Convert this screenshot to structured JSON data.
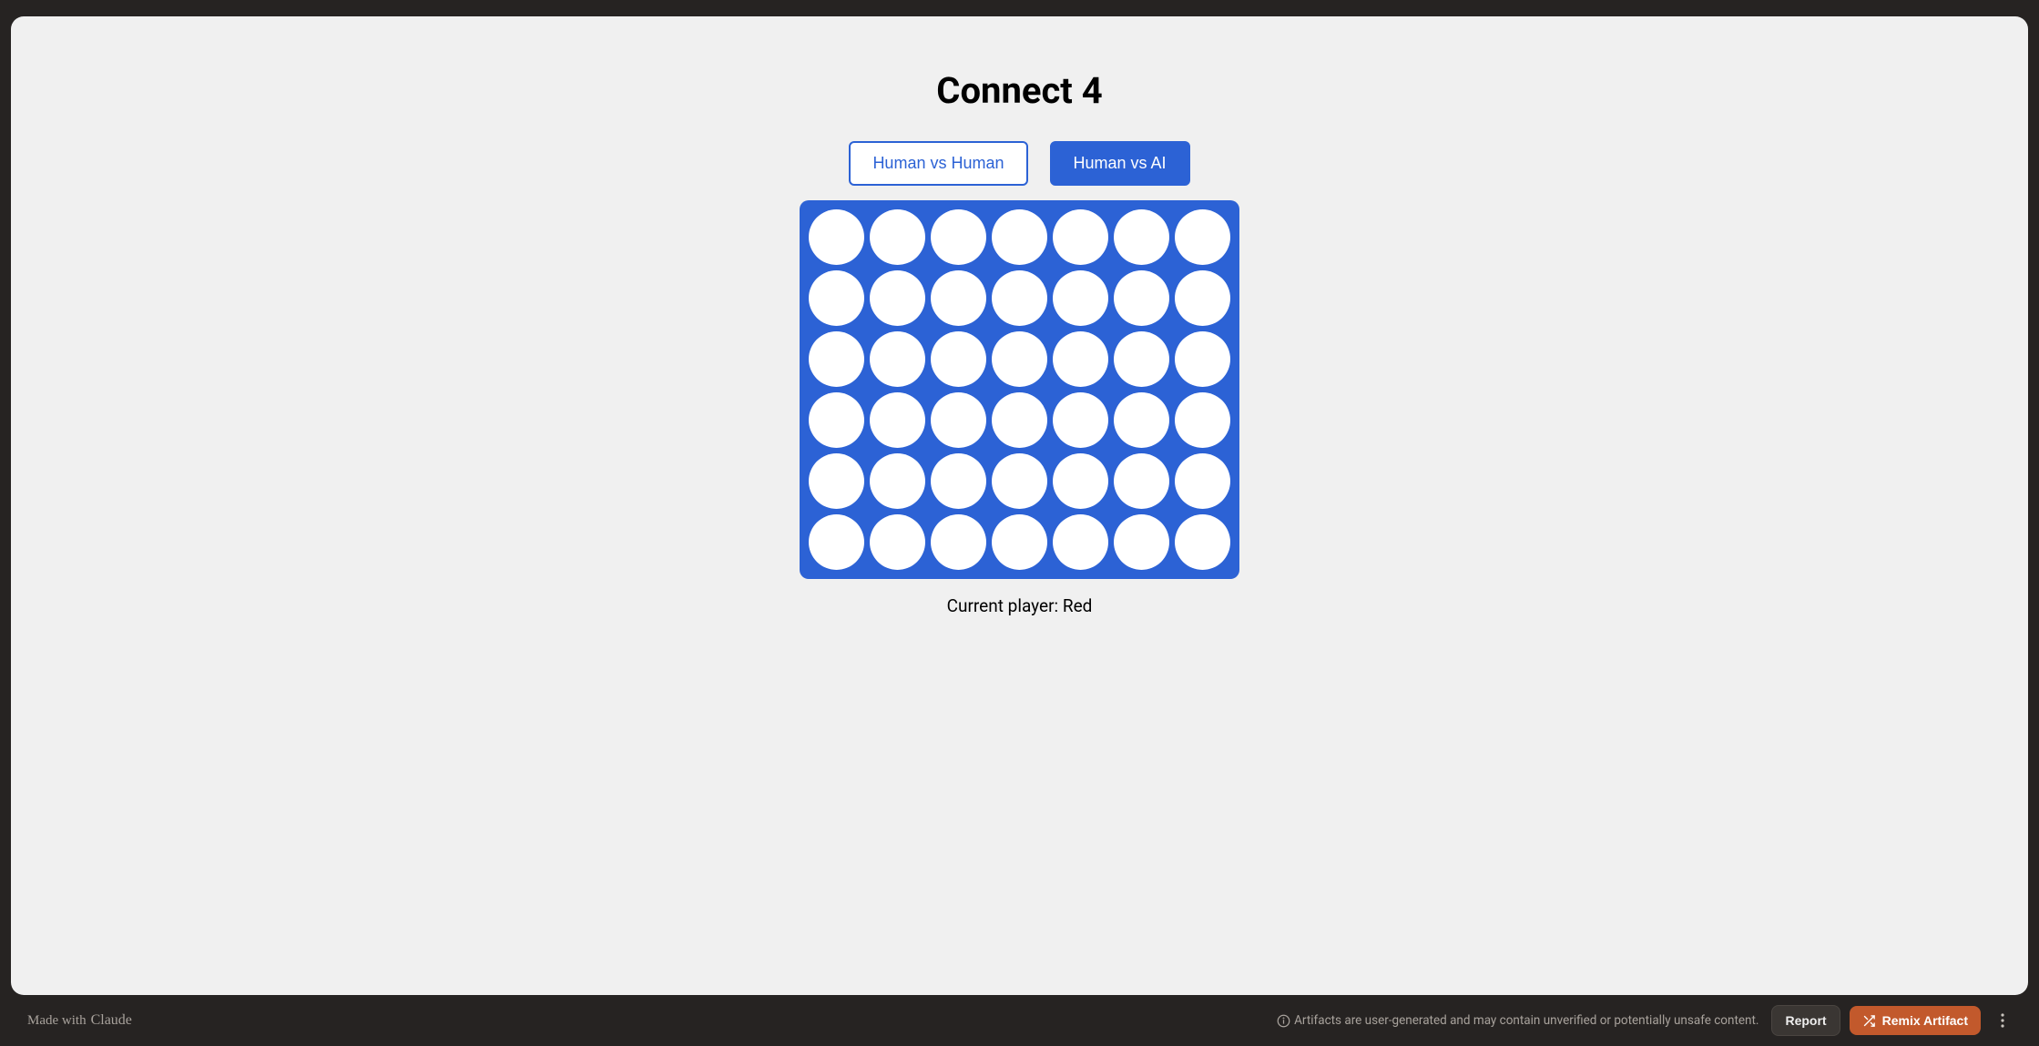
{
  "game": {
    "title": "Connect 4",
    "modes": {
      "human_vs_human": "Human vs Human",
      "human_vs_ai": "Human vs AI",
      "active": "human_vs_ai"
    },
    "board": {
      "rows": 6,
      "cols": 7,
      "cells": [
        [
          "empty",
          "empty",
          "empty",
          "empty",
          "empty",
          "empty",
          "empty"
        ],
        [
          "empty",
          "empty",
          "empty",
          "empty",
          "empty",
          "empty",
          "empty"
        ],
        [
          "empty",
          "empty",
          "empty",
          "empty",
          "empty",
          "empty",
          "empty"
        ],
        [
          "empty",
          "empty",
          "empty",
          "empty",
          "empty",
          "empty",
          "empty"
        ],
        [
          "empty",
          "empty",
          "empty",
          "empty",
          "empty",
          "empty",
          "empty"
        ],
        [
          "empty",
          "empty",
          "empty",
          "empty",
          "empty",
          "empty",
          "empty"
        ]
      ]
    },
    "status": "Current player: Red",
    "colors": {
      "board": "#2c62d5",
      "empty": "#ffffff",
      "accent": "#c2592c"
    }
  },
  "footer": {
    "made_with_prefix": "Made with",
    "made_with_brand": "Claude",
    "disclaimer": "Artifacts are user-generated and may contain unverified or potentially unsafe content.",
    "report_label": "Report",
    "remix_label": "Remix Artifact"
  }
}
